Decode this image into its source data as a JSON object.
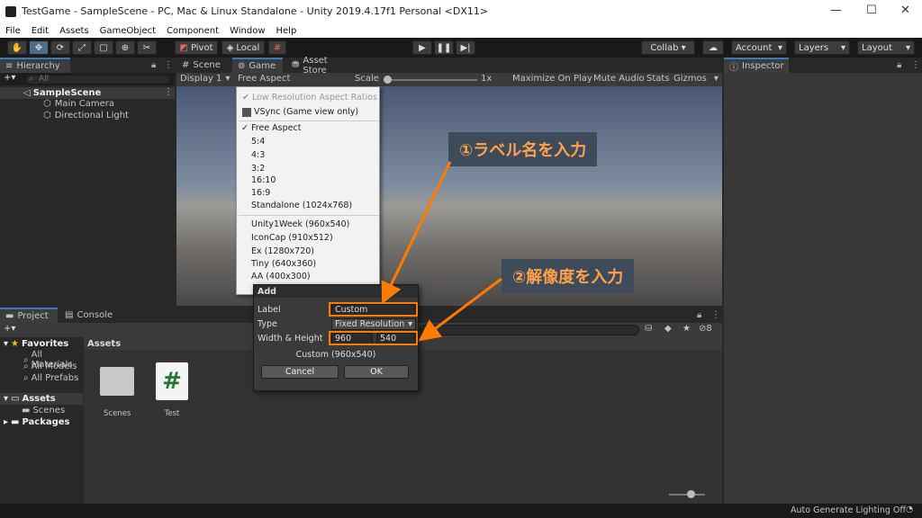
{
  "window": {
    "title": "TestGame - SampleScene - PC, Mac & Linux Standalone - Unity 2019.4.17f1 Personal <DX11>",
    "minimize": "—",
    "maximize": "☐",
    "close": "✕"
  },
  "menu": [
    "File",
    "Edit",
    "Assets",
    "GameObject",
    "Component",
    "Window",
    "Help"
  ],
  "toolbar": {
    "pivot": "Pivot",
    "local": "Local",
    "collab": "Collab ▾",
    "account": "Account",
    "layers": "Layers",
    "layout": "Layout"
  },
  "hierarchy": {
    "tab": "Hierarchy",
    "search_placeholder": "All",
    "scene": "SampleScene",
    "items": [
      "Main Camera",
      "Directional Light"
    ]
  },
  "center_tabs": [
    "Scene",
    "Game",
    "Asset Store"
  ],
  "game_bar": {
    "display": "Display 1",
    "aspect": "Free Aspect",
    "scale_label": "Scale",
    "scale_value": "1x",
    "maximize": "Maximize On Play",
    "mute": "Mute Audio",
    "stats": "Stats",
    "gizmos": "Gizmos"
  },
  "aspect_menu": {
    "low_res": "Low Resolution Aspect Ratios",
    "vsync": "VSync (Game view only)",
    "items": [
      "Free Aspect",
      "5:4",
      "4:3",
      "3:2",
      "16:10",
      "16:9",
      "Standalone (1024x768)"
    ],
    "custom_items": [
      "Unity1Week (960x540)",
      "IconCap (910x512)",
      "Ex (1280x720)",
      "Tiny (640x360)",
      "AA (400x300)"
    ]
  },
  "add_dialog": {
    "title": "Add",
    "label_label": "Label",
    "label_value": "Custom",
    "type_label": "Type",
    "type_value": "Fixed Resolution",
    "wh_label": "Width & Height",
    "width": "960",
    "height": "540",
    "summary": "Custom (960x540)",
    "cancel": "Cancel",
    "ok": "OK"
  },
  "annotations": {
    "step1": "①ラベル名を入力",
    "step2": "②解像度を入力"
  },
  "inspector": {
    "tab": "Inspector"
  },
  "project": {
    "tabs": [
      "Project",
      "Console"
    ],
    "favorites": "Favorites",
    "fav_items": [
      "All Materials",
      "All Models",
      "All Prefabs"
    ],
    "assets_root": "Assets",
    "asset_children": [
      "Scenes"
    ],
    "packages": "Packages",
    "assets_header": "Assets",
    "files": [
      {
        "name": "Scenes",
        "icon": "folder-icon"
      },
      {
        "name": "Test",
        "icon": "csharp-script-icon"
      }
    ],
    "hidden_count": "8"
  },
  "status": {
    "text": "Auto Generate Lighting Off"
  },
  "colors": {
    "accent": "#ff7a00",
    "annotation_bg": "#3e4b5a",
    "selection": "#3a79bb"
  }
}
